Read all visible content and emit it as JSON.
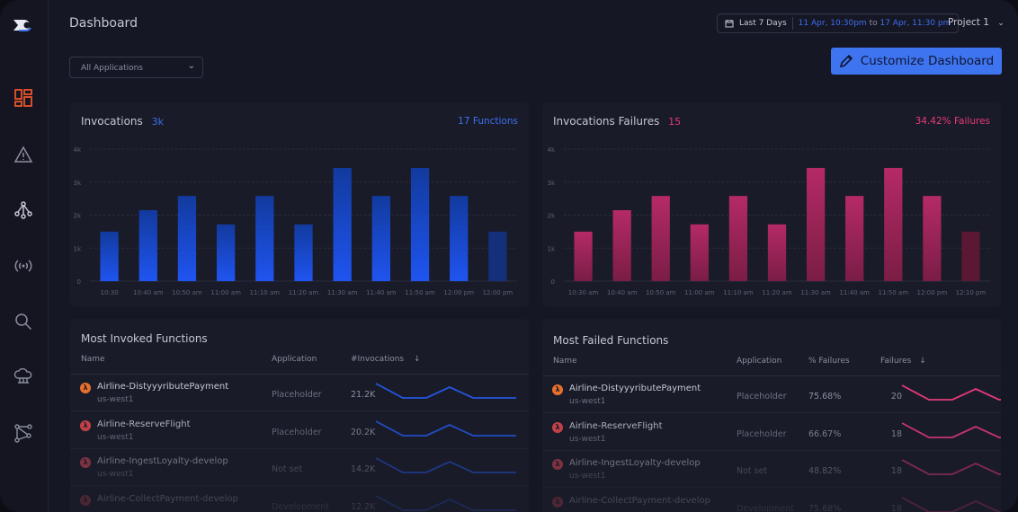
{
  "header": {
    "title": "Dashboard",
    "date_range_label": "Last 7 Days",
    "date_from": "11 Apr, 10:30pm",
    "date_to_word": "to",
    "date_to": "17 Apr, 11:30 pm",
    "project": "Project 1",
    "app_filter": "All Applications",
    "customize_label": "Customize Dashboard"
  },
  "sidebar": {
    "items": [
      "dashboard-icon",
      "alert-icon",
      "topology-icon",
      "signal-icon",
      "search-icon",
      "cloud-icon",
      "graph-icon"
    ],
    "active_color": "#e8542c"
  },
  "colors": {
    "accent": "#3f74f0",
    "failure": "#e43a78"
  },
  "invocations": {
    "title": "Invocations",
    "total": "3k",
    "right": "17 Functions"
  },
  "failures": {
    "title": "Invocations Failures",
    "total": "15",
    "right": "34.42% Failures"
  },
  "chart_data": [
    {
      "type": "bar",
      "title": "Invocations",
      "yticks": [
        "0",
        "1k",
        "2k",
        "3k",
        "4k"
      ],
      "ylim": [
        0,
        4000
      ],
      "categories": [
        "10:30",
        "10:40 am",
        "10:50 am",
        "11:00 am",
        "11:10 am",
        "11:20 am",
        "11:30 am",
        "11:40 am",
        "11:50 am",
        "12:00 pm",
        "12:00 pm"
      ],
      "values": [
        1500,
        2150,
        2580,
        1720,
        2580,
        1720,
        3430,
        2580,
        3430,
        2580,
        1500
      ],
      "color": "#1f54f0",
      "grid": true
    },
    {
      "type": "bar",
      "title": "Invocations Failures",
      "yticks": [
        "0",
        "1k",
        "2k",
        "3k",
        "4k"
      ],
      "ylim": [
        0,
        4000
      ],
      "categories": [
        "10:30 am",
        "10:40 am",
        "10:50 am",
        "11:00 am",
        "11:10 am",
        "11:20 am",
        "11:30 am",
        "11:40 am",
        "11:50 am",
        "12:00 pm",
        "12:10 pm"
      ],
      "values": [
        1500,
        2150,
        2580,
        1720,
        2580,
        1720,
        3430,
        2580,
        3430,
        2580,
        1500
      ],
      "color": "#e03a78",
      "grid": true
    }
  ],
  "most_invoked": {
    "title": "Most Invoked Functions",
    "columns": [
      "Name",
      "Application",
      "#Invocations"
    ],
    "rows": [
      {
        "name": "Airline-DistyyyributePayment",
        "region": "us-west1",
        "app": "Placeholder",
        "value": "21.2K",
        "icon_color": "#e8702c"
      },
      {
        "name": "Airline-ReserveFlight",
        "region": "us-west1",
        "app": "Placeholder",
        "value": "20.2K",
        "icon_color": "#e0484e"
      },
      {
        "name": "Airline-IngestLoyalty-develop",
        "region": "us-west1",
        "app": "Not set",
        "value": "14.2K",
        "icon_color": "#e04a5a"
      },
      {
        "name": "Airline-CollectPayment-develop",
        "region": "",
        "app": "Development",
        "value": "12.2K",
        "icon_color": "#e04a5a"
      }
    ]
  },
  "most_failed": {
    "title": "Most Failed Functions",
    "columns": [
      "Name",
      "Application",
      "% Failures",
      "Failures"
    ],
    "rows": [
      {
        "name": "Airline-DistyyyributePayment",
        "region": "us-west1",
        "app": "Placeholder",
        "pct": "75.68%",
        "value": "20",
        "icon_color": "#e8702c"
      },
      {
        "name": "Airline-ReserveFlight",
        "region": "us-west1",
        "app": "Placeholder",
        "pct": "66.67%",
        "value": "18",
        "icon_color": "#e0484e"
      },
      {
        "name": "Airline-IngestLoyalty-develop",
        "region": "us-west1",
        "app": "Not set",
        "pct": "48.82%",
        "value": "18",
        "icon_color": "#e04a5a"
      },
      {
        "name": "Airline-CollectPayment-develop",
        "region": "",
        "app": "Development",
        "pct": "75.68%",
        "value": "18",
        "icon_color": "#e04a5a"
      }
    ]
  }
}
